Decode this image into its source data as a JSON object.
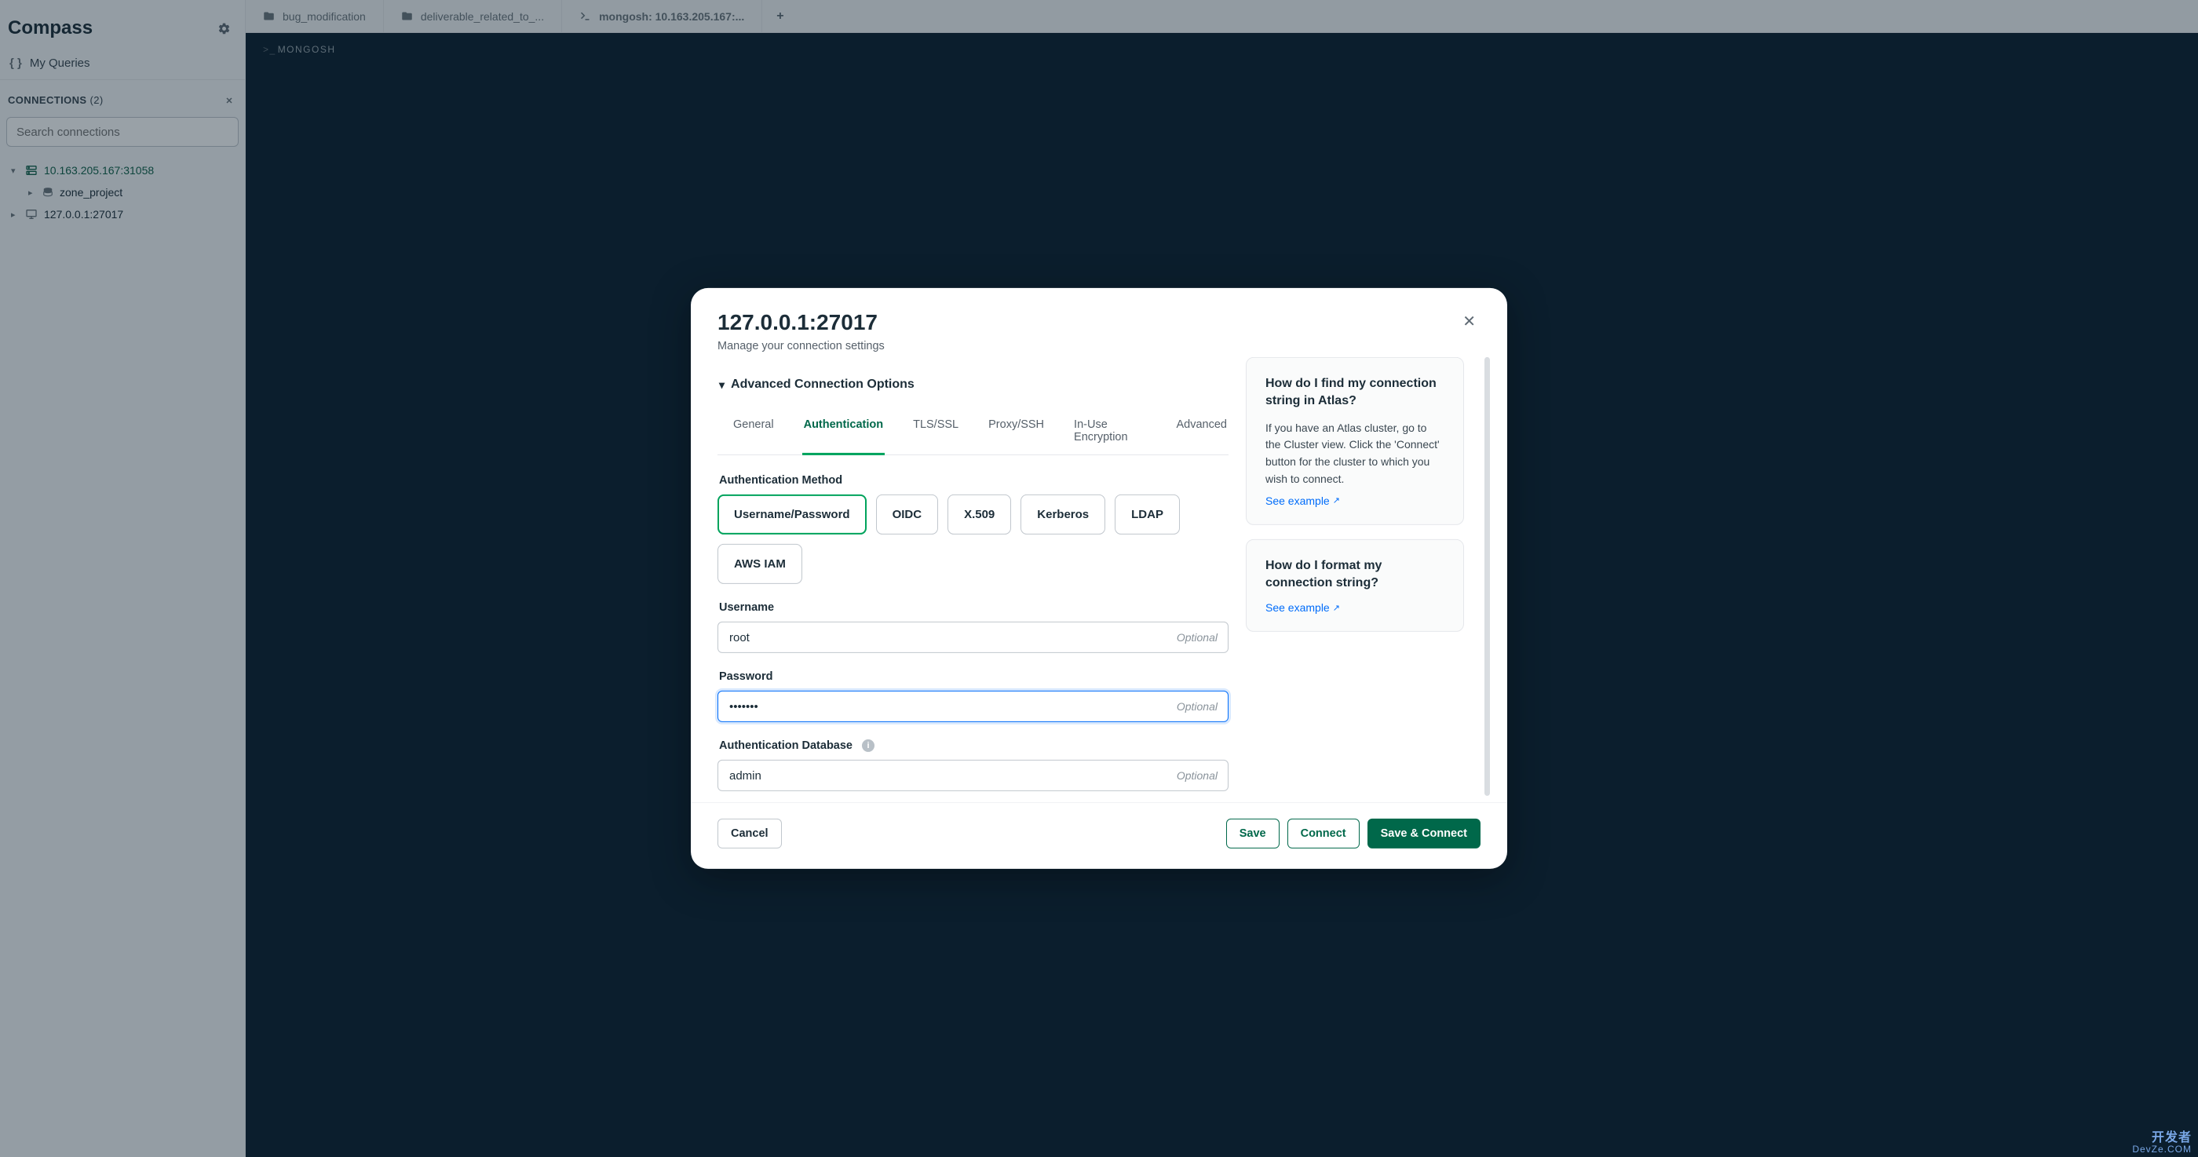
{
  "app": {
    "title": "Compass"
  },
  "myQueries": {
    "label": "My Queries"
  },
  "connections": {
    "label": "CONNECTIONS",
    "count": "(2)"
  },
  "search": {
    "placeholder": "Search connections"
  },
  "tree": {
    "conn1": {
      "label": "10.163.205.167:31058"
    },
    "db1": {
      "label": "zone_project"
    },
    "conn2": {
      "label": "127.0.0.1:27017"
    }
  },
  "tabs": {
    "t1": {
      "label": "bug_modification"
    },
    "t2": {
      "label": "deliverable_related_to_..."
    },
    "t3": {
      "label": "mongosh: 10.163.205.167:..."
    }
  },
  "mongoshBar": {
    "label": "MONGOSH"
  },
  "modal": {
    "title": "127.0.0.1:27017",
    "subtitle": "Manage your connection settings",
    "advanced": "Advanced Connection Options",
    "tabGeneral": "General",
    "tabAuth": "Authentication",
    "tabTls": "TLS/SSL",
    "tabProxy": "Proxy/SSH",
    "tabEnc": "In-Use Encryption",
    "tabAdv": "Advanced",
    "authMethodLabel": "Authentication Method",
    "pills": {
      "up": "Username/Password",
      "oidc": "OIDC",
      "x509": "X.509",
      "kerb": "Kerberos",
      "ldap": "LDAP",
      "aws": "AWS IAM"
    },
    "username": {
      "label": "Username",
      "value": "root",
      "hint": "Optional"
    },
    "password": {
      "label": "Password",
      "value": "•••••••",
      "hint": "Optional"
    },
    "authdb": {
      "label": "Authentication Database",
      "value": "admin",
      "hint": "Optional"
    },
    "help1": {
      "title": "How do I find my connection string in Atlas?",
      "body": "If you have an Atlas cluster, go to the Cluster view. Click the 'Connect' button for the cluster to which you wish to connect.",
      "link": "See example"
    },
    "help2": {
      "title": "How do I format my connection string?",
      "link": "See example"
    },
    "cancel": "Cancel",
    "save": "Save",
    "connect": "Connect",
    "saveConnect": "Save & Connect"
  },
  "watermark": {
    "l1": "开发者",
    "l2": "DevZe.COM"
  }
}
